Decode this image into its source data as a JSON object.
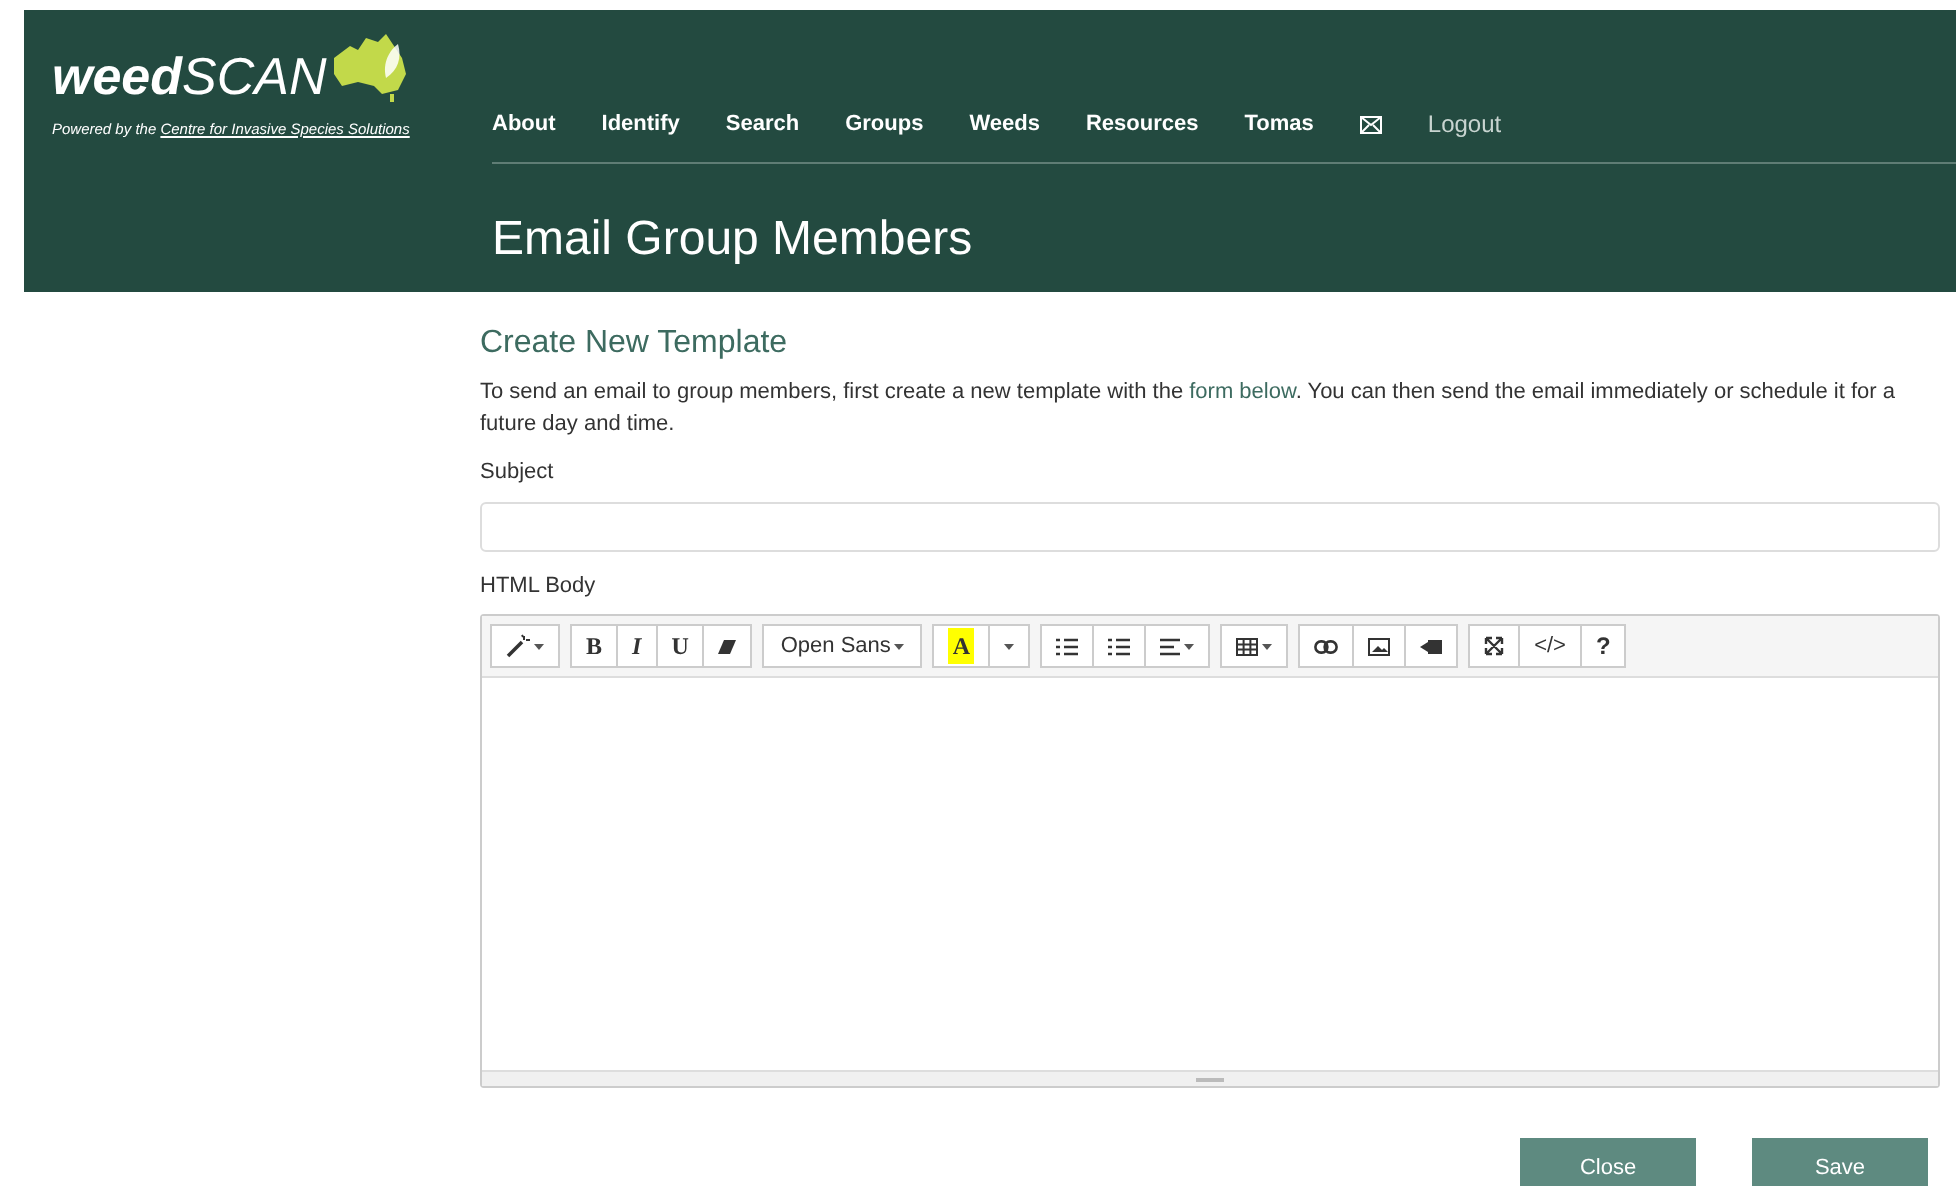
{
  "brand": {
    "bold": "weed",
    "light": "SCAN",
    "tagline": "Powered by the",
    "tagline_link": "Centre for Invasive Species Solutions"
  },
  "nav": [
    {
      "label": "About",
      "kind": "text"
    },
    {
      "label": "Identify",
      "kind": "text"
    },
    {
      "label": "Search",
      "kind": "text"
    },
    {
      "label": "Groups",
      "kind": "text"
    },
    {
      "label": "Weeds",
      "kind": "text"
    },
    {
      "label": "Resources",
      "kind": "text"
    },
    {
      "label": "Tomas",
      "kind": "text"
    },
    {
      "kind": "mail"
    },
    {
      "label": "Logout",
      "kind": "muted"
    }
  ],
  "page_title": "Email Group Members",
  "section": {
    "title": "Create New Template",
    "intro_before": "To send an email to group members, first create a new template with the",
    "intro_link": "form below",
    "intro_after": ". You can then send the email immediately or schedule it for a future day and time."
  },
  "subject": {
    "label": "Subject"
  },
  "body": {
    "label": "HTML Body"
  },
  "toolbar": {
    "bold": "B",
    "italic": "I",
    "underline": "U",
    "font": "Open Sans",
    "highlight": "A",
    "code": "</>",
    "help": "?"
  },
  "buttons": [
    {
      "label": "Close"
    },
    {
      "label": "Save"
    }
  ]
}
